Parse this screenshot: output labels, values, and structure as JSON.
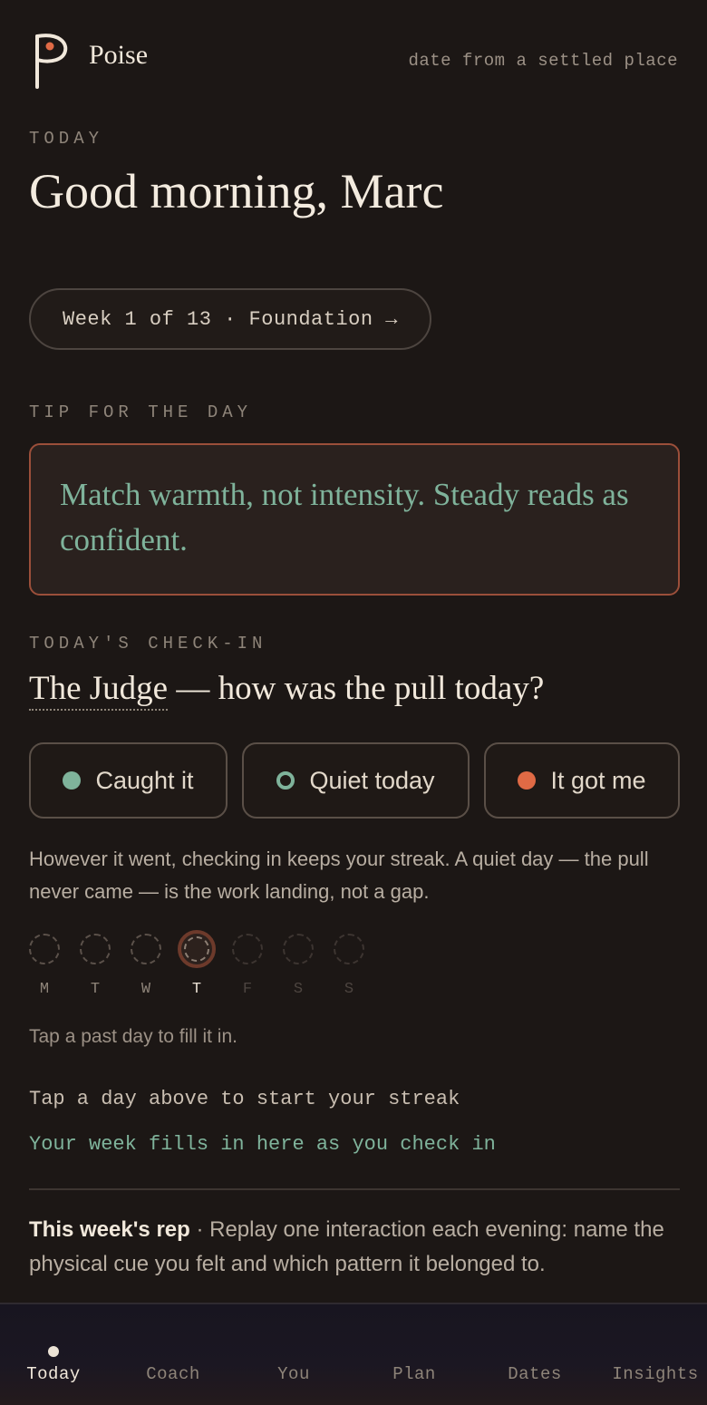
{
  "header": {
    "brand": "Poise",
    "tagline": "date from a settled place"
  },
  "today": {
    "eyebrow": "TODAY",
    "greeting": "Good morning, Marc",
    "week_pill": "Week 1 of 13 · Foundation →"
  },
  "tip": {
    "eyebrow": "TIP FOR THE DAY",
    "text": "Match warmth, not intensity. Steady reads as confident."
  },
  "checkin": {
    "eyebrow": "TODAY'S CHECK-IN",
    "pattern_name": "The Judge",
    "question": " — how was the pull today?",
    "choices": [
      {
        "label": "Caught it",
        "color": "#7fb39b",
        "style": "filled"
      },
      {
        "label": "Quiet today",
        "color": "#7fb39b",
        "style": "ring"
      },
      {
        "label": "It got me",
        "color": "#e06a45",
        "style": "filled"
      }
    ],
    "note": "However it went, checking in keeps your streak. A quiet day — the pull never came — is the work landing, not a gap."
  },
  "week_days": [
    {
      "letter": "M",
      "state": "past"
    },
    {
      "letter": "T",
      "state": "past"
    },
    {
      "letter": "W",
      "state": "past"
    },
    {
      "letter": "T",
      "state": "today"
    },
    {
      "letter": "F",
      "state": "future"
    },
    {
      "letter": "S",
      "state": "future"
    },
    {
      "letter": "S",
      "state": "future"
    }
  ],
  "tap_hint": "Tap a past day to fill it in.",
  "streak": {
    "line1": "Tap a day above to start your streak",
    "line2": "Your week fills in here as you check in"
  },
  "rep": {
    "label": "This week's rep",
    "text": " · Replay one interaction each evening: name the physical cue you felt and which pattern it belonged to."
  },
  "nav": {
    "items": [
      "Today",
      "Coach",
      "You",
      "Plan",
      "Dates",
      "Insights"
    ],
    "active": "Today"
  },
  "colors": {
    "accent_green": "#7fb39b",
    "accent_orange": "#e06a45",
    "background": "#1c1715"
  }
}
